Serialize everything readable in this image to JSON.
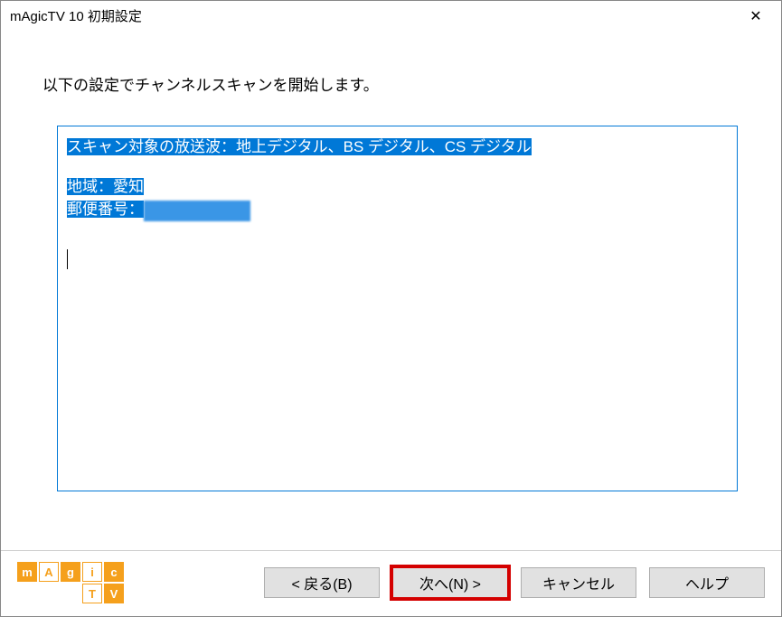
{
  "titlebar": {
    "title": "mAgicTV 10 初期設定"
  },
  "content": {
    "instruction": "以下の設定でチャンネルスキャンを開始します。",
    "line1": "スキャン対象の放送波：地上デジタル、BS デジタル、CS デジタル",
    "line2": "地域：愛知",
    "line3_prefix": "郵便番号："
  },
  "buttons": {
    "back": "< 戻る(B)",
    "next": "次へ(N) >",
    "cancel": "キャンセル",
    "help": "ヘルプ"
  },
  "logo": {
    "row1": [
      "m",
      "A",
      "g",
      "i",
      "c"
    ],
    "row2": [
      "T",
      "V"
    ]
  }
}
